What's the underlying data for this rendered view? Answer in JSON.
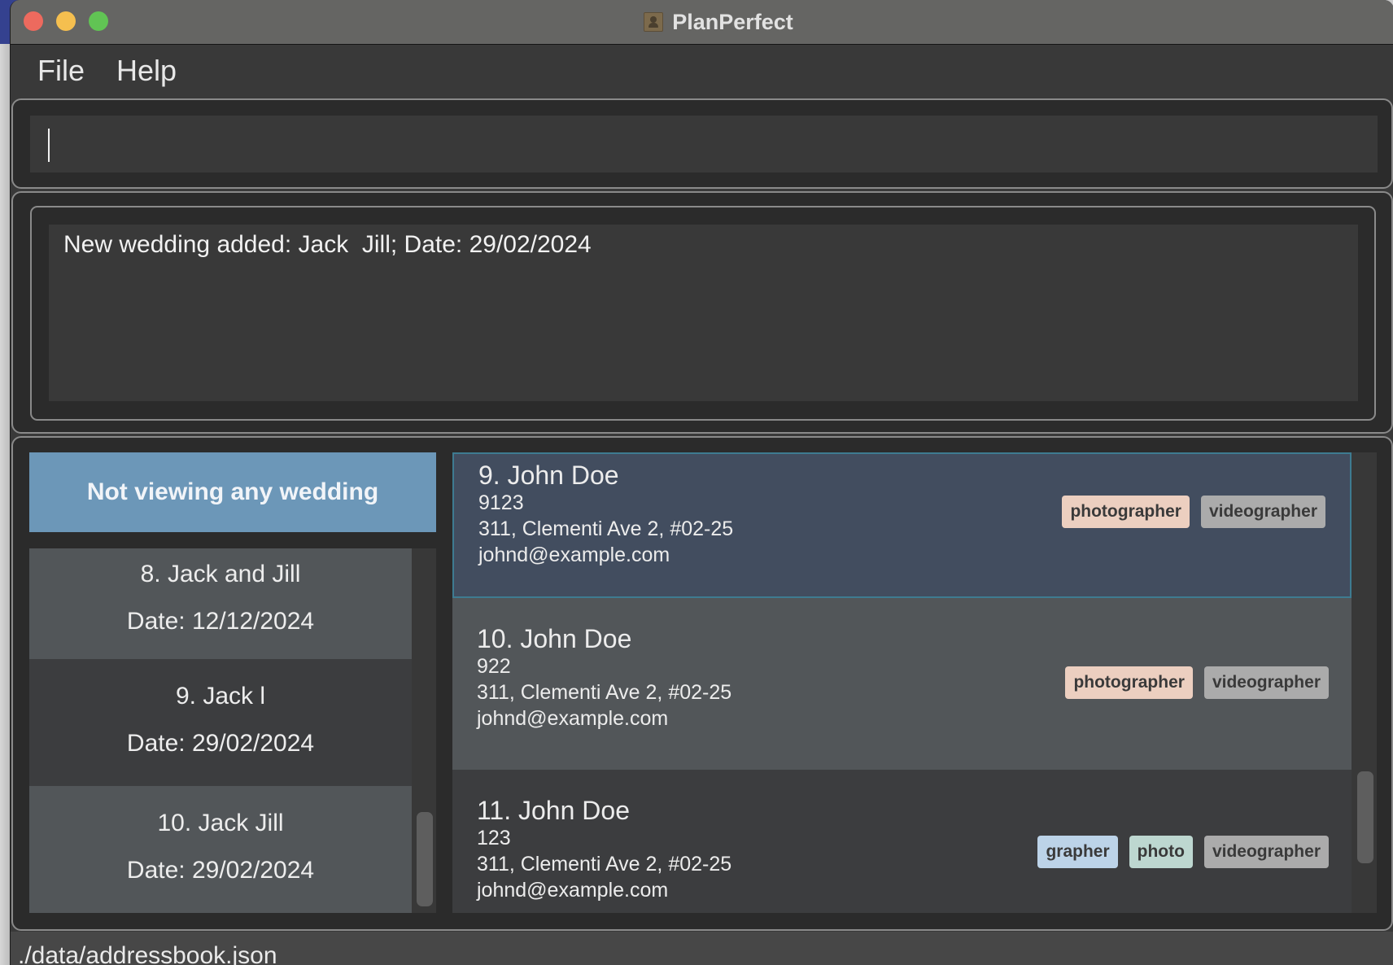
{
  "window": {
    "title": "PlanPerfect",
    "app_icon": "contacts-book-icon"
  },
  "menu": {
    "items": [
      {
        "label": "File"
      },
      {
        "label": "Help"
      }
    ]
  },
  "command": {
    "value": "",
    "placeholder": ""
  },
  "result": {
    "message": "New wedding added: Jack  Jill; Date: 29/02/2024"
  },
  "wedding_panel": {
    "header": "Not viewing any wedding",
    "header_color": "#6c97b8",
    "weddings": [
      {
        "name": "8. Jack  and  Jill",
        "date": "Date: 12/12/2024"
      },
      {
        "name": "9. Jack l",
        "date": "Date: 29/02/2024"
      },
      {
        "name": "10. Jack  Jill",
        "date": "Date: 29/02/2024"
      }
    ]
  },
  "person_panel": {
    "persons": [
      {
        "name": "9. John  Doe",
        "phone": "9123",
        "address": "311, Clementi Ave 2, #02-25",
        "email": "johnd@example.com",
        "selected": true,
        "tags": [
          {
            "label": "photographer",
            "color": "#eccfc0"
          },
          {
            "label": "videographer",
            "color": "#ababab"
          }
        ]
      },
      {
        "name": "10. John  Doe",
        "phone": "922",
        "address": "311, Clementi Ave 2, #02-25",
        "email": "johnd@example.com",
        "selected": false,
        "tags": [
          {
            "label": "photographer",
            "color": "#eccfc0"
          },
          {
            "label": "videographer",
            "color": "#ababab"
          }
        ]
      },
      {
        "name": "11. John Doe",
        "phone": "123",
        "address": "311, Clementi Ave 2, #02-25",
        "email": "johnd@example.com",
        "selected": false,
        "tags": [
          {
            "label": "grapher",
            "color": "#bcd3e8"
          },
          {
            "label": "photo",
            "color": "#bdd7d0"
          },
          {
            "label": "videographer",
            "color": "#ababab"
          }
        ]
      }
    ]
  },
  "status": {
    "file_path": "./data/addressbook.json"
  }
}
